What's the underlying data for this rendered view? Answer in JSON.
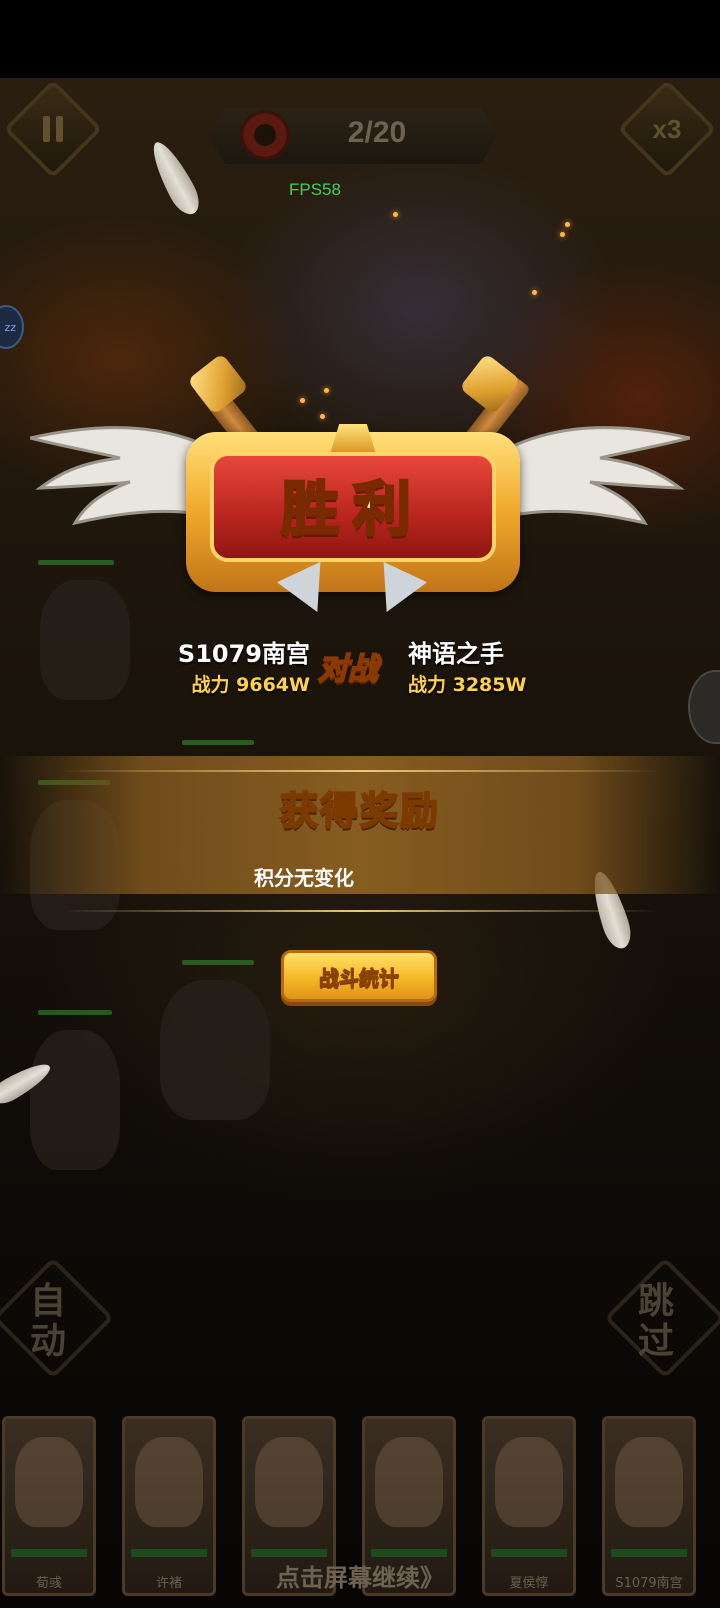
{
  "hud": {
    "wave": "2/20",
    "fps": "FPS58",
    "speed_label": "x3",
    "zz": "zz"
  },
  "result": {
    "title": "胜利",
    "left": {
      "name": "S1079南宫",
      "power": "战力 9664W"
    },
    "vs": "对战",
    "right": {
      "name": "神语之手",
      "power": "战力 3285W"
    }
  },
  "reward": {
    "title": "获得奖励",
    "description": "积分无变化"
  },
  "stats_button": "战斗统计",
  "side_actions": {
    "auto": "自动",
    "skip": "跳过"
  },
  "heroes": [
    {
      "name": "荀彧"
    },
    {
      "name": "许褚"
    },
    {
      "name": ""
    },
    {
      "name": ""
    },
    {
      "name": "夏侯惇"
    },
    {
      "name": "S1079南宫"
    }
  ],
  "continue_hint": "点击屏幕继续》",
  "colors": {
    "accent_gold": "#ffcf4a",
    "victory_red": "#b8241e",
    "fps_green": "#3fd25a"
  }
}
